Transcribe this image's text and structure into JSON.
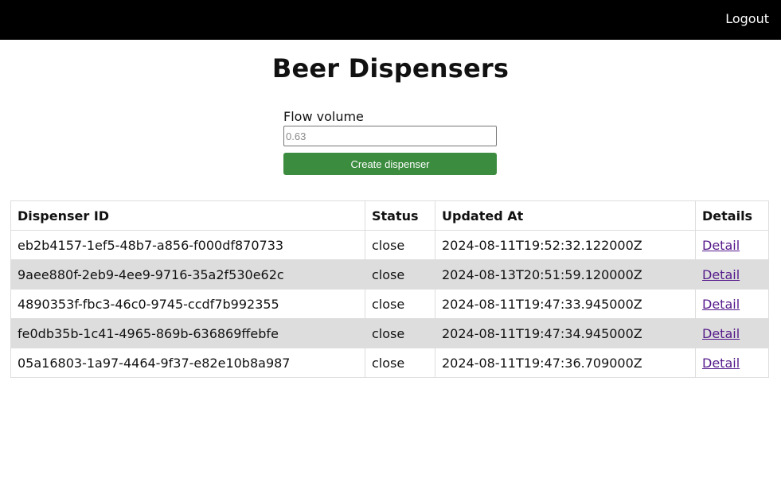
{
  "header": {
    "logout_label": "Logout"
  },
  "page": {
    "title": "Beer Dispensers"
  },
  "form": {
    "flow_label": "Flow volume",
    "flow_placeholder": "0.63",
    "flow_value": "",
    "create_button_label": "Create dispenser"
  },
  "table": {
    "columns": [
      "Dispenser ID",
      "Status",
      "Updated At",
      "Details"
    ],
    "rows": [
      {
        "id": "eb2b4157-1ef5-48b7-a856-f000df870733",
        "status": "close",
        "updated_at": "2024-08-11T19:52:32.122000Z",
        "details": "Detail"
      },
      {
        "id": "9aee880f-2eb9-4ee9-9716-35a2f530e62c",
        "status": "close",
        "updated_at": "2024-08-13T20:51:59.120000Z",
        "details": "Detail"
      },
      {
        "id": "4890353f-fbc3-46c0-9745-ccdf7b992355",
        "status": "close",
        "updated_at": "2024-08-11T19:47:33.945000Z",
        "details": "Detail"
      },
      {
        "id": "fe0db35b-1c41-4965-869b-636869ffebfe",
        "status": "close",
        "updated_at": "2024-08-11T19:47:34.945000Z",
        "details": "Detail"
      },
      {
        "id": "05a16803-1a97-4464-9f37-e82e10b8a987",
        "status": "close",
        "updated_at": "2024-08-11T19:47:36.709000Z",
        "details": "Detail"
      }
    ]
  },
  "colors": {
    "topbar": "#000000",
    "button": "#3c8c3f",
    "row_stripe": "#dddddd",
    "link_visited": "#551a8b"
  }
}
